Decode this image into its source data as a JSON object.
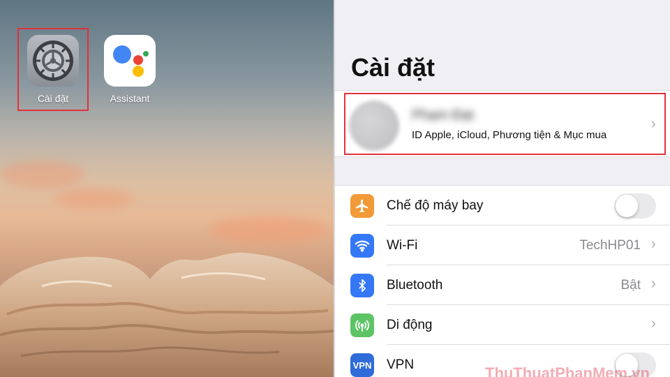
{
  "home_screen": {
    "apps": [
      {
        "label": "Cài đặt",
        "icon": "settings-gear-icon"
      },
      {
        "label": "Assistant",
        "icon": "google-assistant-icon"
      }
    ],
    "highlight_color": "#e0313b"
  },
  "settings": {
    "title": "Cài đặt",
    "profile": {
      "name": "Phạm Đạt",
      "subtitle": "ID Apple, iCloud, Phương tiện & Mục mua"
    },
    "rows": [
      {
        "label": "Chế độ máy bay",
        "icon": "airplane-icon",
        "icon_color": "#f19a37",
        "toggle": "off"
      },
      {
        "label": "Wi-Fi",
        "value": "TechHP01",
        "icon": "wifi-icon",
        "icon_color": "#3478f6"
      },
      {
        "label": "Bluetooth",
        "value": "Bật",
        "icon": "bluetooth-icon",
        "icon_color": "#3478f6"
      },
      {
        "label": "Di động",
        "icon": "cellular-icon",
        "icon_color": "#5dc466"
      },
      {
        "label": "VPN",
        "icon_text": "VPN",
        "icon": "vpn-icon",
        "icon_color": "#2f6bd9",
        "toggle": "off"
      }
    ]
  },
  "watermark": "ThuThuatPhanMem.vn"
}
